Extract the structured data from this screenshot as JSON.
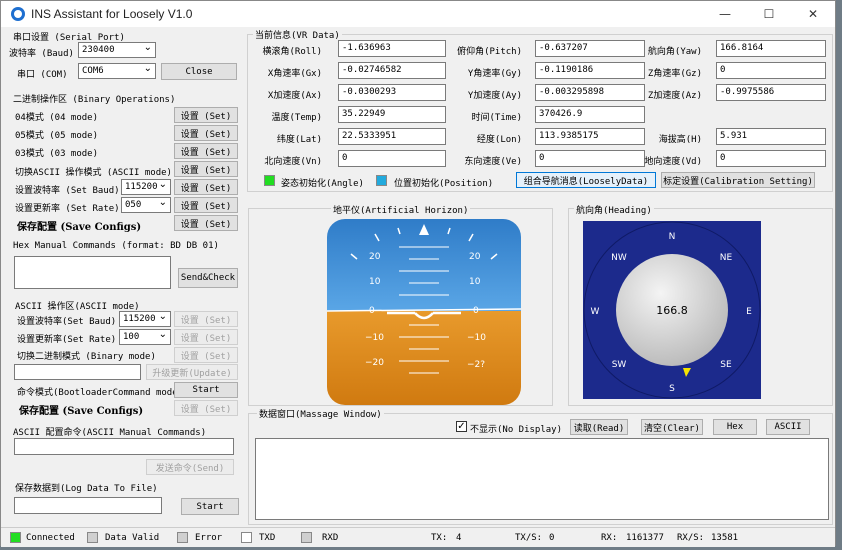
{
  "window": {
    "title": "INS Assistant for Loosely V1.0",
    "minimize": "—",
    "maximize": "☐",
    "close": "✕"
  },
  "serial": {
    "header": "串口设置 (Serial Port)",
    "baud_label": "波特率 (Baud)",
    "baud_value": "230400",
    "port_label": "串口 (COM)",
    "port_value": "COM6",
    "close_btn": "Close"
  },
  "binary": {
    "header": "二进制操作区 (Binary Operations)",
    "rows": [
      {
        "label": "04模式 (04 mode)",
        "btn": "设置 (Set)"
      },
      {
        "label": "05模式 (05 mode)",
        "btn": "设置 (Set)"
      },
      {
        "label": "03模式 (03 mode)",
        "btn": "设置 (Set)"
      },
      {
        "label": "切换ASCII 操作模式 (ASCII mode)",
        "btn": "设置 (Set)"
      },
      {
        "label": "设置波特率 (Set Baud)",
        "btn": "设置 (Set)",
        "value": "115200"
      },
      {
        "label": "设置更新率 (Set Rate)",
        "btn": "设置 (Set)",
        "value": "050"
      },
      {
        "label": "保存配置 (Save Configs)",
        "btn": "设置 (Set)"
      }
    ]
  },
  "hex": {
    "header": "Hex Manual Commands (format: BD DB 01)",
    "send_btn": "Send&Check"
  },
  "ascii": {
    "header": "ASCII 操作区(ASCII mode)",
    "baud_label": "设置波特率(Set Baud)",
    "baud_value": "115200",
    "rate_label": "设置更新率(Set Rate)",
    "rate_value": "100",
    "binary_label": "切换二进制模式 (Binary mode)",
    "set_btn": "设置 (Set)",
    "upgrade_btn": "升级更新(Update)",
    "bootloader_label": "命令模式(BootloaderCommand mode)",
    "start_btn": "Start",
    "save_label": "保存配置 (Save Configs)"
  },
  "ascii_manual": {
    "header": "ASCII 配置命令(ASCII Manual Commands)",
    "send_btn": "发送命令(Send)"
  },
  "log": {
    "header": "保存数据到(Log Data To File)",
    "start_btn": "Start"
  },
  "vr": {
    "header": "当前信息(VR Data)",
    "fields": [
      {
        "label": "横滚角(Roll)",
        "value": "-1.636963"
      },
      {
        "label": "俯仰角(Pitch)",
        "value": "-0.637207"
      },
      {
        "label": "航向角(Yaw)",
        "value": "166.8164"
      },
      {
        "label": "X角速率(Gx)",
        "value": "-0.02746582"
      },
      {
        "label": "Y角速率(Gy)",
        "value": "-0.1190186"
      },
      {
        "label": "Z角速率(Gz)",
        "value": "0"
      },
      {
        "label": "X加速度(Ax)",
        "value": "-0.0300293"
      },
      {
        "label": "Y加速度(Ay)",
        "value": "-0.003295898"
      },
      {
        "label": "Z加速度(Az)",
        "value": "-0.9975586"
      },
      {
        "label": "温度(Temp)",
        "value": "35.22949"
      },
      {
        "label": "时间(Time)",
        "value": "370426.9"
      },
      {
        "label": "纬度(Lat)",
        "value": "22.5333951"
      },
      {
        "label": "经度(Lon)",
        "value": "113.9385175"
      },
      {
        "label": "海拔高(H)",
        "value": "5.931"
      },
      {
        "label": "北向速度(Vn)",
        "value": "0"
      },
      {
        "label": "东向速度(Ve)",
        "value": "0"
      },
      {
        "label": "地向速度(Vd)",
        "value": "0"
      }
    ]
  },
  "indicators": {
    "angle_label": "姿态初始化(Angle)",
    "angle_color": "#22dd22",
    "position_label": "位置初始化(Position)",
    "position_color": "#22aadd",
    "loosely_btn": "组合导航消息(LooselyData)",
    "calib_btn": "标定设置(Calibration Setting)"
  },
  "horizon": {
    "header": "地平仪(Artificial Horizon)",
    "sky_color": "#3c8fd6",
    "ground_color": "#e08a1c",
    "pitch_labels_left": [
      "20",
      "10",
      "0",
      "−10",
      "−20"
    ],
    "pitch_labels_right": [
      "20",
      "10",
      "0",
      "−10",
      "−2?"
    ]
  },
  "heading": {
    "header": "航向角(Heading)",
    "value": "166.8",
    "ring_color": "#1c2a8c",
    "labels": [
      "N",
      "NE",
      "E",
      "SE",
      "S",
      "SW",
      "W",
      "NW"
    ]
  },
  "messages": {
    "header": "数据窗口(Massage Window)",
    "nodisplay_label": "不显示(No Display)",
    "read_btn": "读取(Read)",
    "clear_btn": "清空(Clear)",
    "hex_btn": "Hex",
    "ascii_btn": "ASCII"
  },
  "status": {
    "connected": "Connected",
    "connected_color": "#22dd22",
    "data_valid": "Data Valid",
    "error": "Error",
    "txd": "TXD",
    "rxd": "RXD",
    "tx_label": "TX:",
    "tx_value": "4",
    "txs_label": "TX/S:",
    "txs_value": "0",
    "rx_label": "RX:",
    "rx_value": "1161377",
    "rxs_label": "RX/S:",
    "rxs_value": "13581"
  }
}
